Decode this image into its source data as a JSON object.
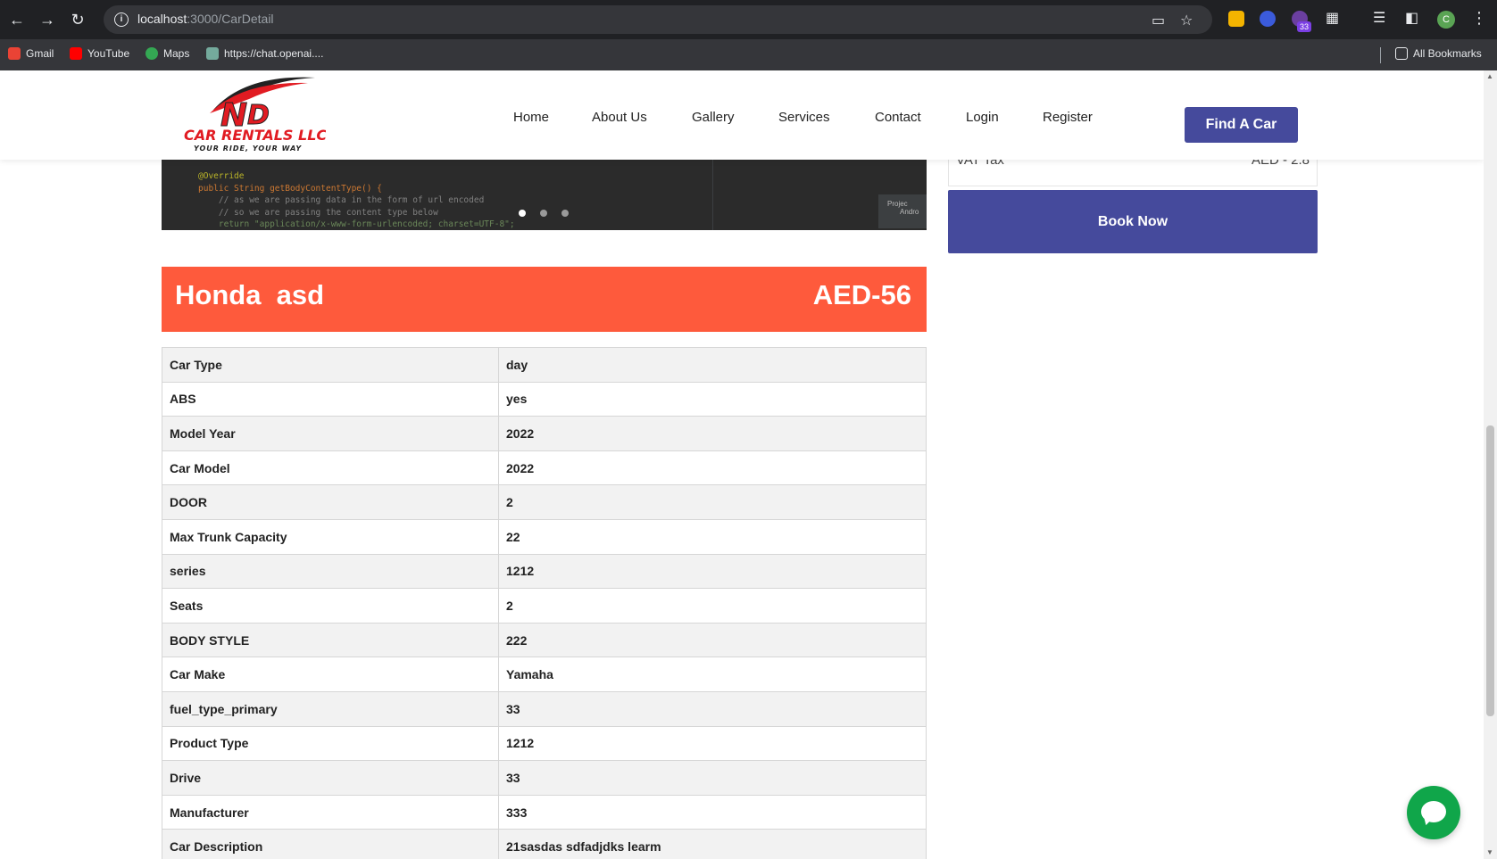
{
  "browser": {
    "url_host": "localhost",
    "url_rest": ":3000/CarDetail",
    "bookmarks": [
      "Gmail",
      "YouTube",
      "Maps",
      "https://chat.openai...."
    ],
    "all_bookmarks": "All Bookmarks",
    "extension_badge": "33",
    "profile_initial": "C"
  },
  "site": {
    "logo_main": "CAR RENTALS LLC",
    "logo_tagline": "YOUR RIDE, YOUR WAY",
    "nav": [
      "Home",
      "About Us",
      "Gallery",
      "Services",
      "Contact",
      "Login",
      "Register"
    ],
    "find_car": "Find A Car"
  },
  "slider": {
    "code_lines": [
      "@Override",
      "public String getBodyContentType() {",
      "    // as we are passing data in the form of url encoded",
      "    // so we are passing the content type below",
      "    return \"application/x-www-form-urlencoded; charset=UTF-8\";"
    ],
    "popup_line1": "Projec",
    "popup_line2": "Andro"
  },
  "sidebar": {
    "vat_label": "VAT Tax",
    "vat_value": "AED - 2.8",
    "book_now": "Book Now"
  },
  "car": {
    "name": "Honda  asd",
    "price": "AED-56",
    "specs": [
      {
        "label": "Car Type",
        "value": "day"
      },
      {
        "label": "ABS",
        "value": "yes"
      },
      {
        "label": "Model Year",
        "value": "2022"
      },
      {
        "label": "Car Model",
        "value": "2022"
      },
      {
        "label": "DOOR",
        "value": "2"
      },
      {
        "label": "Max Trunk Capacity",
        "value": "22"
      },
      {
        "label": "series",
        "value": "1212"
      },
      {
        "label": "Seats",
        "value": "2"
      },
      {
        "label": "BODY STYLE",
        "value": "222"
      },
      {
        "label": "Car Make",
        "value": "Yamaha"
      },
      {
        "label": "fuel_type_primary",
        "value": "33"
      },
      {
        "label": "Product Type",
        "value": "1212"
      },
      {
        "label": "Drive",
        "value": "33"
      },
      {
        "label": "Manufacturer",
        "value": "333"
      },
      {
        "label": "Car Description",
        "value": "21sasdas sdfadjdks learm"
      }
    ]
  },
  "colors": {
    "brand_red": "#fe5a3c",
    "brand_blue": "#454a9c",
    "chat_green": "#10a64a"
  }
}
